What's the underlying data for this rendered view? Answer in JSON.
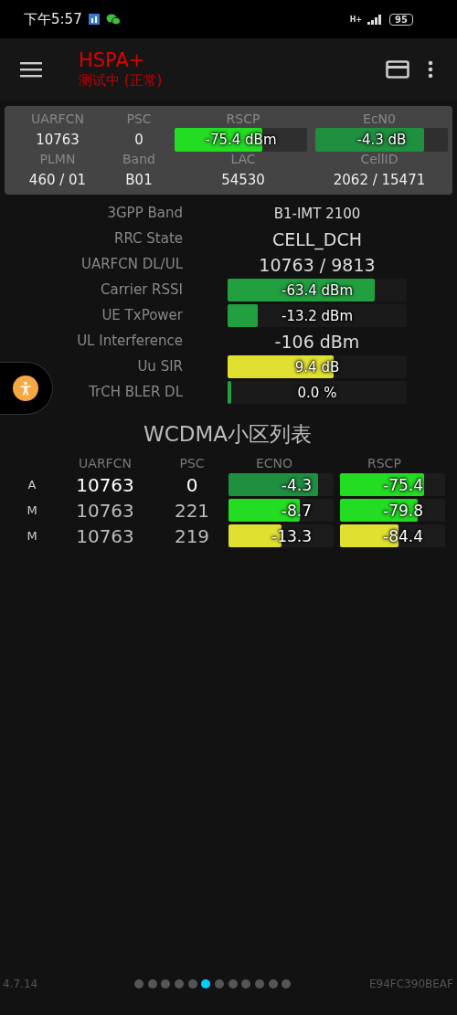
{
  "status_bar": {
    "time": "下午5:57",
    "network": "H+",
    "battery": "95"
  },
  "app_bar": {
    "title": "HSPA+",
    "subtitle": "测试中 (正常)"
  },
  "summary": {
    "row1": [
      {
        "label": "UARFCN",
        "value": "10763"
      },
      {
        "label": "PSC",
        "value": "0"
      },
      {
        "label": "RSCP",
        "value": "-75.4 dBm",
        "level": 0.66,
        "color": "#22dd22"
      },
      {
        "label": "EcN0",
        "value": "-4.3 dB",
        "level": 0.82,
        "color": "#1f8f40"
      }
    ],
    "row2": [
      {
        "label": "PLMN",
        "value": "460 / 01"
      },
      {
        "label": "Band",
        "value": "B01"
      },
      {
        "label": "LAC",
        "value": "54530"
      },
      {
        "label": "CellID",
        "value": "2062 / 15471"
      }
    ]
  },
  "details": [
    {
      "kind": "text",
      "label": "3GPP Band",
      "value": "B1-IMT 2100"
    },
    {
      "kind": "big_text",
      "label": "RRC State",
      "value": "CELL_DCH"
    },
    {
      "kind": "big_text",
      "label": "UARFCN DL/UL",
      "value": "10763 / 9813"
    },
    {
      "kind": "bar",
      "label": "Carrier RSSI",
      "value": "-63.4 dBm",
      "level": 0.82,
      "color": "#22a040"
    },
    {
      "kind": "bar",
      "label": "UE TxPower",
      "value": "-13.2 dBm",
      "level": 0.17,
      "color": "#22a040"
    },
    {
      "kind": "big_text",
      "label": "UL Interference",
      "value": "-106 dBm"
    },
    {
      "kind": "bar",
      "label": "Uu SIR",
      "value": "9.4 dB",
      "level": 0.59,
      "color": "#e0e030"
    },
    {
      "kind": "bar",
      "label": "TrCH BLER DL",
      "value": "0.0 %",
      "level": 0.02,
      "color": "#22a040"
    }
  ],
  "cell_list": {
    "title": "WCDMA小区列表",
    "columns": [
      "UARFCN",
      "PSC",
      "ECNO",
      "RSCP"
    ],
    "rows": [
      {
        "type": "A",
        "uarfcn": "10763",
        "psc": "0",
        "active": true,
        "ecno": {
          "value": "-4.3",
          "level": 0.85,
          "color": "#1f8f40"
        },
        "rscp": {
          "value": "-75.4",
          "level": 0.8,
          "color": "#22dd22"
        }
      },
      {
        "type": "M",
        "uarfcn": "10763",
        "psc": "221",
        "active": false,
        "ecno": {
          "value": "-8.7",
          "level": 0.68,
          "color": "#22dd22"
        },
        "rscp": {
          "value": "-79.8",
          "level": 0.74,
          "color": "#22dd22"
        }
      },
      {
        "type": "M",
        "uarfcn": "10763",
        "psc": "219",
        "active": false,
        "ecno": {
          "value": "-13.3",
          "level": 0.5,
          "color": "#e0e030"
        },
        "rscp": {
          "value": "-84.4",
          "level": 0.56,
          "color": "#e0e030"
        }
      }
    ]
  },
  "footer": {
    "version": "4.7.14",
    "device_id": "E94FC390BEAF",
    "pages": [
      {
        "selected": false
      },
      {
        "selected": false
      },
      {
        "selected": false
      },
      {
        "selected": false
      },
      {
        "selected": false
      },
      {
        "selected": true
      },
      {
        "selected": false
      },
      {
        "selected": false
      },
      {
        "selected": false
      },
      {
        "selected": false
      },
      {
        "selected": false
      },
      {
        "selected": false
      }
    ]
  }
}
